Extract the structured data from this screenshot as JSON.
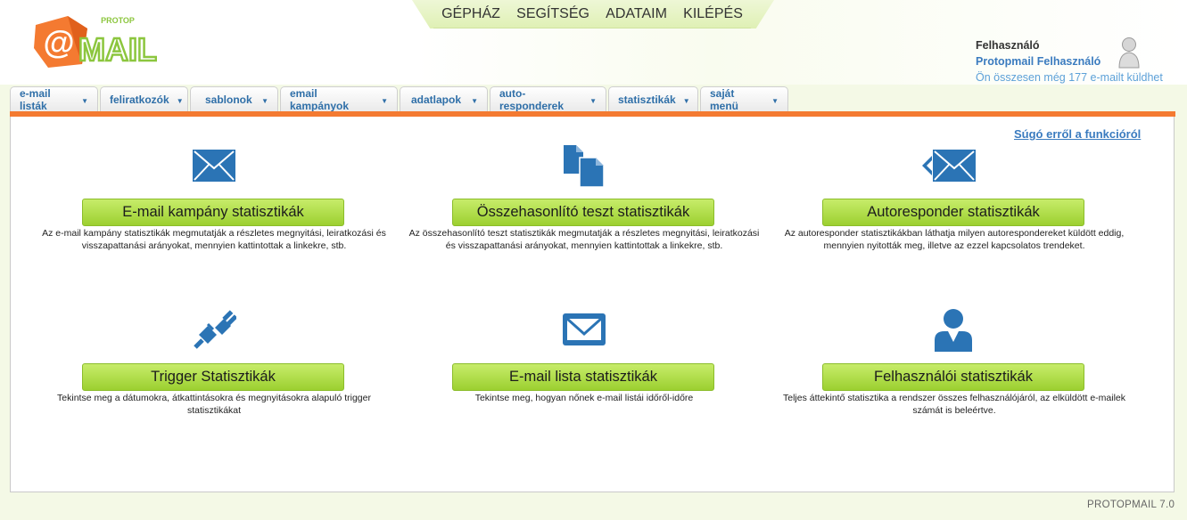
{
  "logo": {
    "small_text": "PROTOP",
    "big_text": "MAIL"
  },
  "topnav": [
    "GÉPHÁZ",
    "SEGÍTSÉG",
    "ADATAIM",
    "KILÉPÉS"
  ],
  "user": {
    "role": "Felhasználó",
    "name": "Protopmail Felhasználó",
    "quota": "Ön összesen még 177 e-mailt küldhet"
  },
  "tabs": [
    "e-mail listák",
    "feliratkozók",
    "sablonok",
    "email kampányok",
    "adatlapok",
    "auto-responderek",
    "statisztikák",
    "saját menü"
  ],
  "help_link": "Súgó erről a funkcióról",
  "cards": [
    {
      "title": "E-mail kampány statisztikák",
      "desc": "Az e-mail kampány statisztikák megmutatják a részletes megnyitási, leiratkozási és visszapattanási arányokat, mennyien kattintottak a linkekre, stb.",
      "icon": "envelope-icon"
    },
    {
      "title": "Összehasonlító teszt statisztikák",
      "desc": "Az összehasonlító teszt statisztikák megmutatják a részletes megnyitási, leiratkozási és visszapattanási arányokat, mennyien kattintottak a linkekre, stb.",
      "icon": "documents-icon"
    },
    {
      "title": "Autoresponder statisztikák",
      "desc": "Az autoresponder statisztikákban láthatja milyen autorespondereket küldött eddig, mennyien nyitották meg, illetve az ezzel kapcsolatos trendeket.",
      "icon": "envelope-back-icon"
    },
    {
      "title": "Trigger Statisztikák",
      "desc": "Tekintse meg a dátumokra, átkattintásokra és megnyitásokra alapuló trigger statisztikákat",
      "icon": "plug-icon"
    },
    {
      "title": "E-mail lista statisztikák",
      "desc": "Tekintse meg, hogyan nőnek e-mail listái időről-időre",
      "icon": "mail-box-icon"
    },
    {
      "title": "Felhasználói statisztikák",
      "desc": "Teljes áttekintő statisztika a rendszer összes felhasználójáról, az elküldött e-mailek számát is beleértve.",
      "icon": "user-icon"
    }
  ],
  "version": "PROTOPMAIL 7.0",
  "colors": {
    "accent_orange": "#f47a31",
    "link_blue": "#3a7bbf",
    "button_green": "#9cd030",
    "icon_blue": "#2b74b5"
  }
}
